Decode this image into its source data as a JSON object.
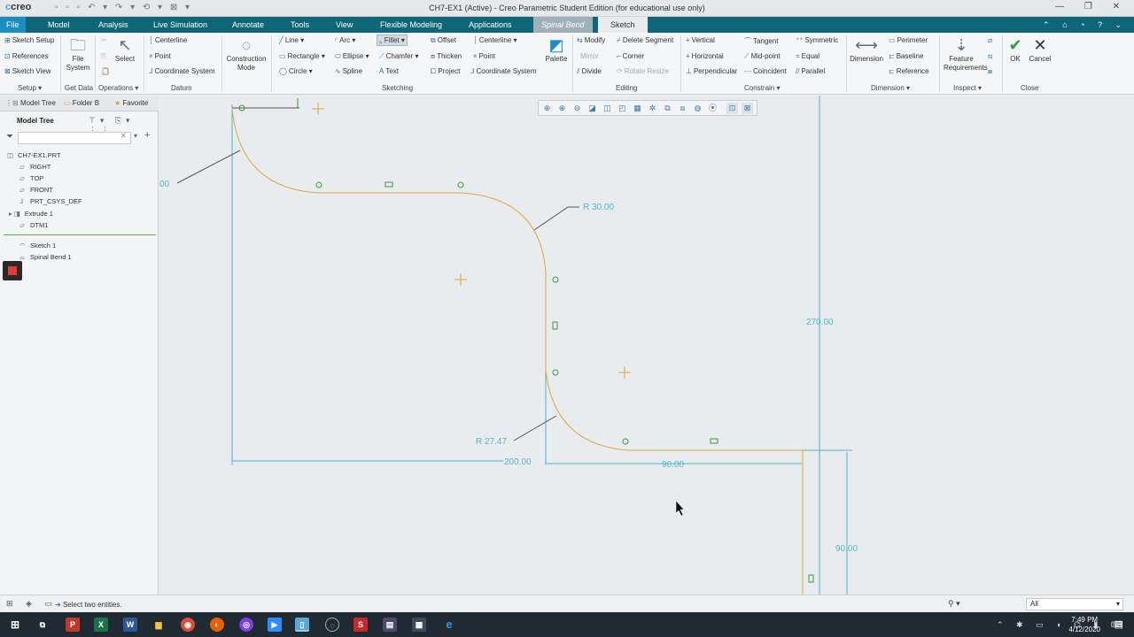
{
  "app": {
    "logo": "creo",
    "window_title": "CH7-EX1 (Active) - Creo Parametric Student Edition (for educational use only)"
  },
  "menu": {
    "tabs": [
      "File",
      "Model",
      "Analysis",
      "Live Simulation",
      "Annotate",
      "Tools",
      "View",
      "Flexible Modeling",
      "Applications",
      "Spinal Bend",
      "Sketch"
    ]
  },
  "ribbon": {
    "setup": {
      "sketch_setup": "Sketch Setup",
      "references": "References",
      "sketch_view": "Sketch View",
      "group": "Setup"
    },
    "getdata": {
      "file_system": "File System",
      "group": "Get Data"
    },
    "operations": {
      "select": "Select",
      "group": "Operations"
    },
    "datum": {
      "centerline": "Centerline",
      "point": "Point",
      "coord_sys": "Coordinate System",
      "group": "Datum"
    },
    "construction": {
      "label": "Construction Mode"
    },
    "sketching": {
      "line": "Line",
      "arc": "Arc",
      "fillet": "Fillet",
      "offset": "Offset",
      "centerline": "Centerline",
      "rectangle": "Rectangle",
      "ellipse": "Ellipse",
      "chamfer": "Chamfer",
      "thicken": "Thicken",
      "point": "Point",
      "circle": "Circle",
      "spline": "Spline",
      "text": "Text",
      "project": "Project",
      "coord_sys": "Coordinate System",
      "palette": "Palette",
      "group": "Sketching"
    },
    "editing": {
      "modify": "Modify",
      "delete_segment": "Delete Segment",
      "mirror": "Mirror",
      "corner": "Corner",
      "divide": "Divide",
      "rotate_resize": "Rotate Resize",
      "group": "Editing"
    },
    "constrain": {
      "vertical": "Vertical",
      "tangent": "Tangent",
      "symmetric": "Symmetric",
      "horizontal": "Horizontal",
      "midpoint": "Mid-point",
      "equal": "Equal",
      "perpendicular": "Perpendicular",
      "coincident": "Coincident",
      "parallel": "Parallel",
      "group": "Constrain"
    },
    "dimension": {
      "dimension": "Dimension",
      "perimeter": "Perimeter",
      "baseline": "Baseline",
      "reference": "Reference",
      "group": "Dimension"
    },
    "inspect": {
      "feature_requirements": "Feature Requirements",
      "group": "Inspect"
    },
    "close": {
      "ok": "OK",
      "cancel": "Cancel",
      "group": "Close"
    }
  },
  "leftpanel": {
    "tabs": [
      "Model Tree",
      "Folder B",
      "Favorite"
    ],
    "header": "Model Tree",
    "search_value": "",
    "tree": [
      "CH7-EX1.PRT",
      "RIGHT",
      "TOP",
      "FRONT",
      "PRT_CSYS_DEF",
      "Extrude 1",
      "DTM1",
      "Sketch 1",
      "Spinal Bend 1"
    ]
  },
  "sketch": {
    "dims": {
      "partial": "00",
      "r30": "R 30.00",
      "r2747": "R 27.47",
      "d200": "200.00",
      "d90a": "90.00",
      "d270": "270.00",
      "d90b": "90.00"
    }
  },
  "status": {
    "message": "Select two entities.",
    "filter": "All"
  },
  "taskbar": {
    "time": "7:49 PM",
    "date": "4/12/2020"
  }
}
